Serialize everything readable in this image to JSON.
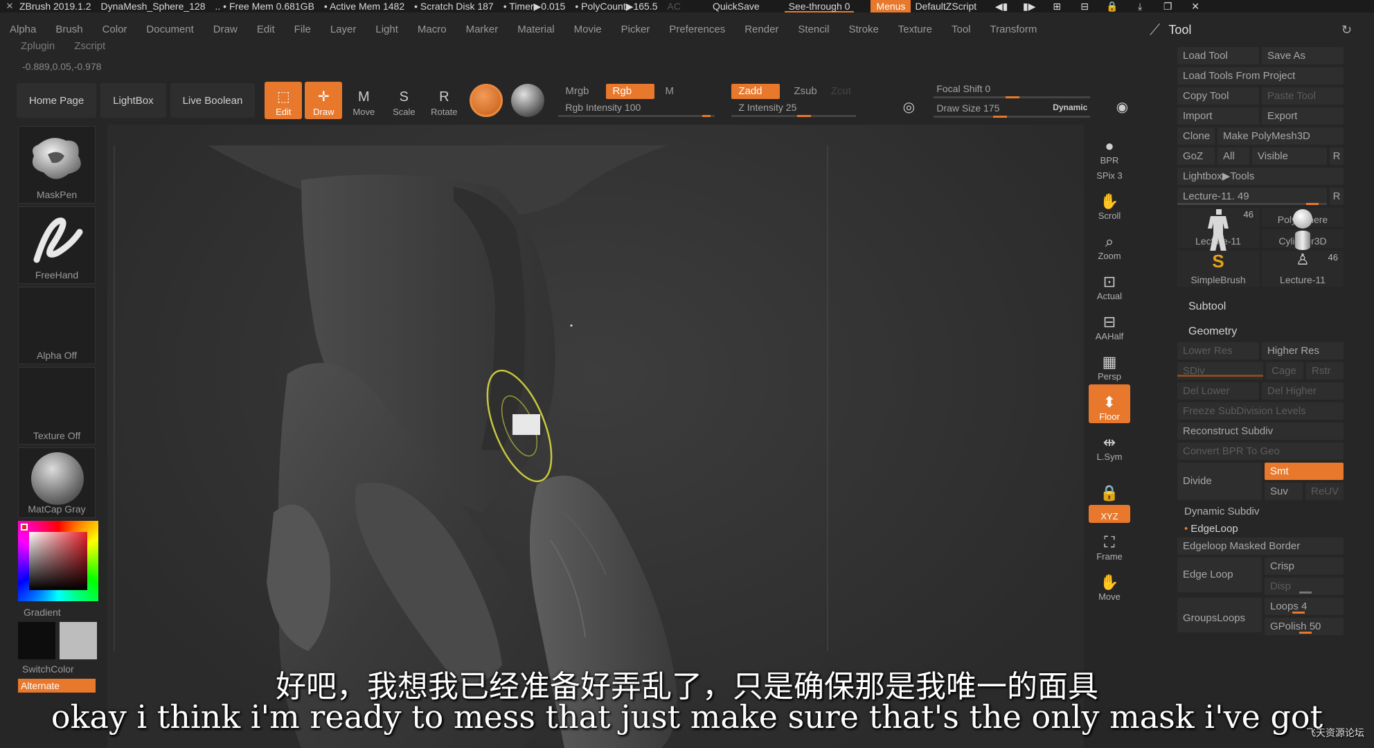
{
  "titlebar": {
    "app": "ZBrush 2019.1.2",
    "doc": "DynaMesh_Sphere_128",
    "free_mem": ".. • Free Mem 0.681GB",
    "active_mem": "• Active Mem 1482",
    "scratch": "• Scratch Disk 187",
    "timer": "• Timer▶0.015",
    "polycount": "• PolyCount▶165.5",
    "ac": "AC",
    "quicksave": "QuickSave",
    "seethrough": "See-through  0",
    "menus": "Menus",
    "script": "DefaultZScript"
  },
  "menus": [
    "Alpha",
    "Brush",
    "Color",
    "Document",
    "Draw",
    "Edit",
    "File",
    "Layer",
    "Light",
    "Macro",
    "Marker",
    "Material",
    "Movie",
    "Picker",
    "Preferences",
    "Render",
    "Stencil",
    "Stroke",
    "Texture",
    "Tool",
    "Transform"
  ],
  "menus2": [
    "Zplugin",
    "Zscript"
  ],
  "coords": "-0.889,0.05,-0.978",
  "shelf": {
    "home": "Home Page",
    "lightbox": "LightBox",
    "liveboolean": "Live Boolean",
    "edit": "Edit",
    "draw": "Draw",
    "move": "Move",
    "scale": "Scale",
    "rotate": "Rotate",
    "mrgb": "Mrgb",
    "rgb": "Rgb",
    "m": "M",
    "zadd": "Zadd",
    "zsub": "Zsub",
    "zcut": "Zcut",
    "rgb_intensity": "Rgb Intensity 100",
    "z_intensity": "Z Intensity 25",
    "focal_shift": "Focal Shift 0",
    "draw_size": "Draw Size 175",
    "dynamic": "Dynamic"
  },
  "left": {
    "brush": "MaskPen",
    "stroke": "FreeHand",
    "alpha": "Alpha Off",
    "texture": "Texture Off",
    "material": "MatCap Gray",
    "gradient": "Gradient",
    "switchcolor": "SwitchColor",
    "alternate": "Alternate"
  },
  "righticons": [
    {
      "label": "BPR",
      "icon": "sphere-icon"
    },
    {
      "label": "SPix 3",
      "icon": "spix-icon"
    },
    {
      "label": "Scroll",
      "icon": "hand-icon"
    },
    {
      "label": "Zoom",
      "icon": "zoom-icon"
    },
    {
      "label": "Actual",
      "icon": "actual-icon"
    },
    {
      "label": "AAHalf",
      "icon": "aahalf-icon"
    },
    {
      "label": "Persp",
      "icon": "persp-icon"
    },
    {
      "label": "Floor",
      "icon": "floor-icon"
    },
    {
      "label": "L.Sym",
      "icon": "sym-icon"
    },
    {
      "label": "",
      "icon": "lock-icon"
    },
    {
      "label": "XYZ",
      "icon": "xyz-icon"
    },
    {
      "label": "Frame",
      "icon": "frame-icon"
    },
    {
      "label": "Move",
      "icon": "move-hand-icon"
    }
  ],
  "tool": {
    "title": "Tool",
    "load_tool": "Load Tool",
    "save_as": "Save As",
    "load_project": "Load Tools From Project",
    "copy_tool": "Copy Tool",
    "paste_tool": "Paste Tool",
    "import": "Import",
    "export": "Export",
    "clone": "Clone",
    "make_polymesh": "Make PolyMesh3D",
    "goz": "GoZ",
    "all": "All",
    "visible": "Visible",
    "r": "R",
    "lightbox_tools": "Lightbox▶Tools",
    "lecture_slider": "Lecture-11. 49",
    "thumbs": [
      {
        "label": "Lecture-11",
        "num": "46"
      },
      {
        "label": "PolySphere",
        "num": ""
      },
      {
        "label": "Cylinder3D",
        "num": ""
      },
      {
        "label": "SimpleBrush",
        "num": ""
      },
      {
        "label": "Lecture-11",
        "num": "46"
      }
    ],
    "subtool": "Subtool",
    "geometry": "Geometry",
    "lower_res": "Lower Res",
    "higher_res": "Higher Res",
    "sdiv": "SDiv",
    "cage": "Cage",
    "rstr": "Rstr",
    "del_lower": "Del Lower",
    "del_higher": "Del Higher",
    "freeze": "Freeze SubDivision Levels",
    "reconstruct": "Reconstruct Subdiv",
    "convert_bpr": "Convert BPR To Geo",
    "divide": "Divide",
    "smt": "Smt",
    "suv": "Suv",
    "reuv": "ReUV",
    "dynamic_subdiv": "Dynamic Subdiv",
    "edgeloop": "EdgeLoop",
    "edgeloop_masked": "Edgeloop Masked Border",
    "edge_loop": "Edge Loop",
    "crisp": "Crisp",
    "disp": "Disp",
    "groupsloops": "GroupsLoops",
    "loops": "Loops 4",
    "gpolish": "GPolish 50"
  },
  "subtitles": {
    "zh": "好吧，我想我已经准备好弄乱了，只是确保那是我唯一的面具",
    "en": "okay i think i'm ready to mess that just make sure that's the only mask i've got"
  },
  "watermark": "飞天资源论坛"
}
